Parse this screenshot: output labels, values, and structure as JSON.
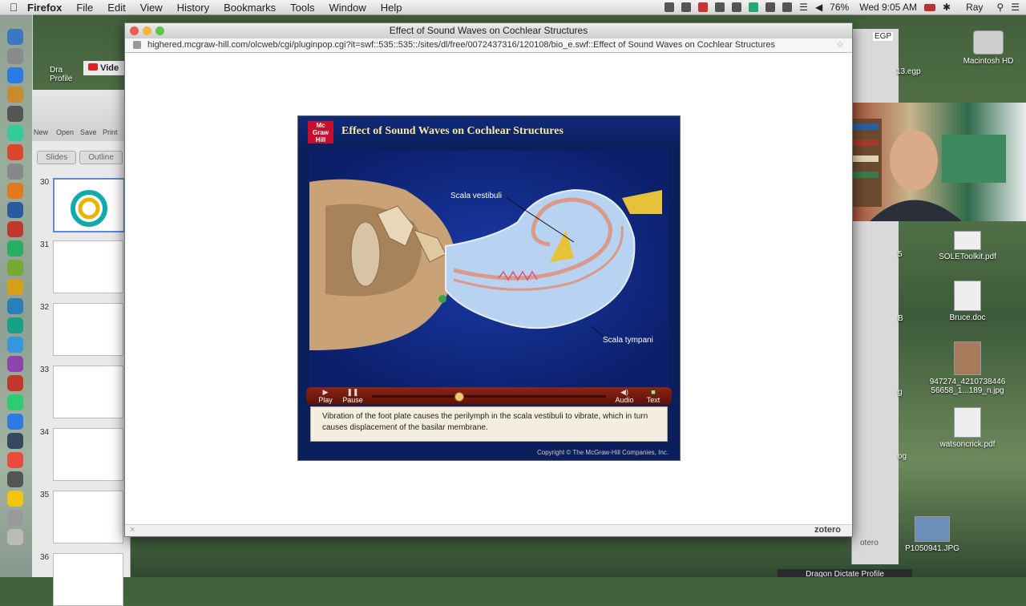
{
  "menubar": {
    "app_name": "Firefox",
    "menus": [
      "File",
      "Edit",
      "View",
      "History",
      "Bookmarks",
      "Tools",
      "Window",
      "Help"
    ],
    "battery": "76%",
    "clock": "Wed 9:05 AM",
    "user": "Ray"
  },
  "firefox": {
    "window_title": "Effect of Sound Waves on Cochlear Structures",
    "url": "highered.mcgraw-hill.com/olcweb/cgi/pluginpop.cgi?it=swf::535::535::/sites/dl/free/0072437316/120108/bio_e.swf::Effect of Sound Waves on Cochlear Structures",
    "status_right": "zotero"
  },
  "player": {
    "logo": "Mc Graw Hill",
    "title": "Effect of Sound Waves on Cochlear Structures",
    "labels": {
      "scala_vestibuli": "Scala vestibuli",
      "scala_tympani": "Scala tympani"
    },
    "controls": {
      "play": "Play",
      "pause": "Pause",
      "audio": "Audio",
      "text": "Text",
      "progress": 0.37
    },
    "caption": "Vibration of the foot plate causes the perilymph in the scala vestibuli to vibrate, which in turn causes displacement of the basilar membrane.",
    "copyright": "Copyright © The McGraw-Hill Companies, Inc."
  },
  "ppt": {
    "toolbar": [
      "New",
      "Open",
      "Save",
      "Print"
    ],
    "tabs": [
      "Slides",
      "Outline"
    ],
    "slides": [
      "30",
      "31",
      "32",
      "33",
      "34",
      "35",
      "36"
    ]
  },
  "background": {
    "youtube_tab": "Vide",
    "dragon_label": "Dra Profile",
    "egp_label": "13.egp",
    "egp_badge": "EGP",
    "macintosh": "Macintosh HD",
    "dragon_bar": "Dragon Dictate Profile",
    "zotero_bg": "otero",
    "desk_left_num": "5",
    "desk_left_b": "B",
    "desk_left_g": "g",
    "desk_left_og": "og"
  },
  "desktop": {
    "items": [
      {
        "label": "SOLEToolkit.pdf"
      },
      {
        "label": "Bruce.doc"
      },
      {
        "label": "947274_4210738446 56658_1...189_n.jpg"
      },
      {
        "label": "watsoncrick.pdf"
      },
      {
        "label": "P1050941.JPG"
      }
    ]
  }
}
